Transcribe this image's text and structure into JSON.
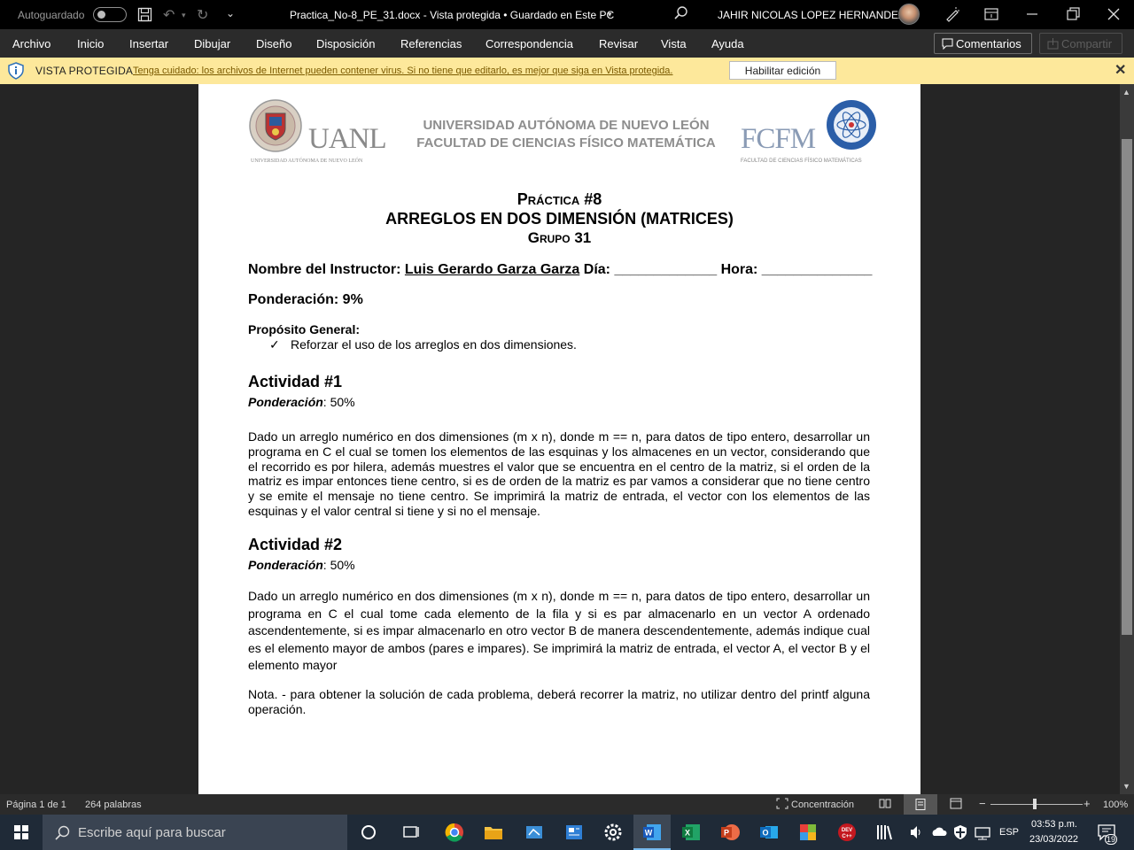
{
  "titlebar": {
    "autosave_label": "Autoguardado",
    "document_title": "Practica_No-8_PE_31.docx  -  Vista protegida • Guardado en Este PC",
    "user_name": "JAHIR NICOLAS LOPEZ HERNANDEZ"
  },
  "menu": {
    "items": [
      "Archivo",
      "Inicio",
      "Insertar",
      "Dibujar",
      "Diseño",
      "Disposición",
      "Referencias",
      "Correspondencia",
      "Revisar",
      "Vista",
      "Ayuda"
    ],
    "comments": "Comentarios",
    "share": "Compartir"
  },
  "protected_bar": {
    "label": "VISTA PROTEGIDA",
    "message": "Tenga cuidado: los archivos de Internet pueden contener virus. Si no tiene que editarlo, es mejor que siga en Vista protegida.",
    "enable_button": "Habilitar edición"
  },
  "document": {
    "header": {
      "uanl": "UANL",
      "uanl_sub": "UNIVERSIDAD AUTÓNOMA DE NUEVO LEÓN",
      "university_line1": "UNIVERSIDAD AUTÓNOMA DE NUEVO LEÓN",
      "university_line2": "FACULTAD DE CIENCIAS FÍSICO MATEMÁTICA",
      "fcfm": "FCFM",
      "fcfm_sub": "FACULTAD DE CIENCIAS FÍSICO MATEMÁTICAS"
    },
    "title_practica": "Práctica #8",
    "title_main": "ARREGLOS EN DOS DIMENSIÓN (MATRICES)",
    "title_grupo": "Grupo 31",
    "instructor_label": "Nombre del Instructor: ",
    "instructor_name": "Luis Gerardo Garza Garza",
    "dia_label": " Día: ",
    "dia_blank": "_____________",
    "hora_label": " Hora: ",
    "hora_blank": "______________",
    "ponderacion": "Ponderación: 9%",
    "proposito_label": "Propósito General:",
    "check_mark": "✓",
    "proposito_item": "Reforzar el uso de los arreglos en dos dimensiones.",
    "act1_title": "Actividad #1",
    "act1_pond_label": "Ponderación",
    "act1_pond_value": ": 50%",
    "act1_text": "Dado un arreglo numérico en dos dimensiones (m x n), donde m == n, para datos de tipo entero, desarrollar un programa en C el cual se tomen los elementos de las esquinas y los almacenes en un vector, considerando que el recorrido es por hilera, además muestres el valor que se encuentra en el centro de la matriz, si el orden de la matriz es impar entonces tiene centro, si es de orden de la matriz es par vamos a considerar que no tiene centro y se emite el mensaje no tiene centro. Se imprimirá la matriz de entrada, el vector con los elementos de las esquinas y el valor central si tiene y si no el mensaje.",
    "act2_title": "Actividad #2",
    "act2_pond_label": "Ponderación",
    "act2_pond_value": ": 50%",
    "act2_text": "Dado un arreglo numérico en dos dimensiones (m x n), donde m == n, para datos de tipo entero, desarrollar un programa en C el cual tome cada elemento de la fila y si es par almacenarlo en un vector A ordenado ascendentemente, si es impar almacenarlo en otro vector B de manera descendentemente, además indique cual es el elemento mayor de ambos (pares e impares). Se imprimirá la matriz de entrada, el vector A, el vector B y el elemento mayor",
    "nota": "Nota. - para obtener la solución de cada problema, deberá recorrer la matriz, no utilizar dentro del printf alguna operación."
  },
  "statusbar": {
    "page": "Página 1 de 1",
    "words": "264 palabras",
    "focus": "Concentración",
    "zoom": "100%"
  },
  "taskbar": {
    "search_placeholder": "Escribe aquí para buscar",
    "lang": "ESP",
    "time": "03:53 p.m.",
    "date": "23/03/2022",
    "notifications": "19"
  }
}
